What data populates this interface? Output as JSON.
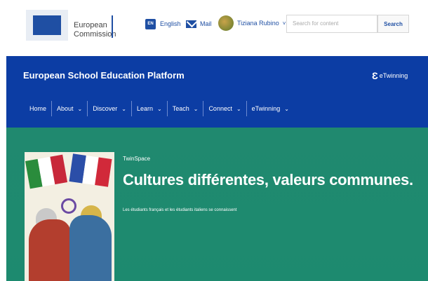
{
  "topbar": {
    "ec_logo_line1": "European",
    "ec_logo_line2": "Commission",
    "language_code": "EN",
    "language_label": "English",
    "mail_label": "Mail",
    "user_name": "Tiziana Rubino",
    "user_caret": "˅",
    "search_placeholder": "Search for content",
    "search_button": "Search"
  },
  "header": {
    "title": "European School Education Platform",
    "etwinning_logo_mark": "Ɛ",
    "etwinning_logo_text": "eTwinning"
  },
  "nav": {
    "items": [
      {
        "label": "Home"
      },
      {
        "label": "About",
        "caret": "⌄"
      },
      {
        "label": "Discover",
        "caret": "⌄"
      },
      {
        "label": "Learn",
        "caret": "⌄"
      },
      {
        "label": "Teach",
        "caret": "⌄"
      },
      {
        "label": "Connect",
        "caret": "⌄"
      },
      {
        "label": "eTwinning",
        "caret": "⌄"
      }
    ]
  },
  "hero": {
    "eyebrow": "TwinSpace",
    "title": "Cultures différentes, valeurs communes.",
    "subtitle": "Les étudiants français et les étudiants italiens se connaissent"
  },
  "colors": {
    "brand_blue": "#0c3da4",
    "hero_teal": "#1d8a6f"
  }
}
